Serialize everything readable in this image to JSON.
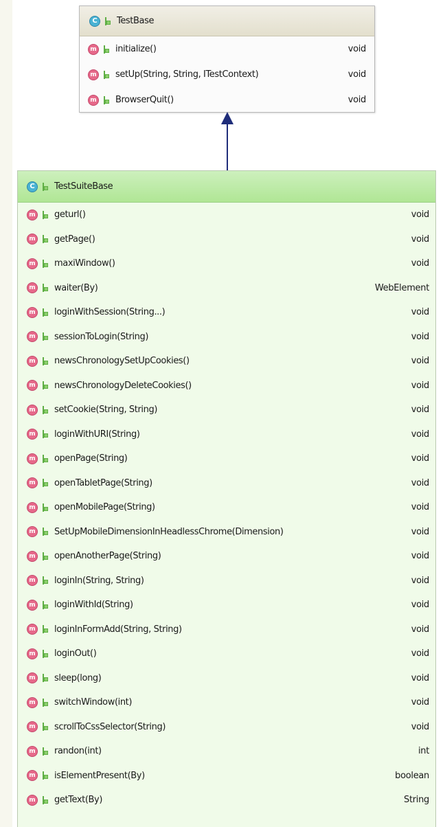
{
  "parent_class": {
    "name": "TestBase",
    "icon": "class-icon",
    "methods": [
      {
        "name": "initialize()",
        "type": "void"
      },
      {
        "name": "setUp(String, String, ITestContext)",
        "type": "void"
      },
      {
        "name": "BrowserQuit()",
        "type": "void"
      }
    ]
  },
  "child_class": {
    "name": "TestSuiteBase",
    "icon": "class-icon",
    "methods": [
      {
        "name": "geturl()",
        "type": "void"
      },
      {
        "name": "getPage()",
        "type": "void"
      },
      {
        "name": "maxiWindow()",
        "type": "void"
      },
      {
        "name": "waiter(By)",
        "type": "WebElement"
      },
      {
        "name": "loginWithSession(String...)",
        "type": "void"
      },
      {
        "name": "sessionToLogin(String)",
        "type": "void"
      },
      {
        "name": "newsChronologySetUpCookies()",
        "type": "void"
      },
      {
        "name": "newsChronologyDeleteCookies()",
        "type": "void"
      },
      {
        "name": "setCookie(String, String)",
        "type": "void"
      },
      {
        "name": "loginWithURI(String)",
        "type": "void"
      },
      {
        "name": "openPage(String)",
        "type": "void"
      },
      {
        "name": "openTabletPage(String)",
        "type": "void"
      },
      {
        "name": "openMobilePage(String)",
        "type": "void"
      },
      {
        "name": "SetUpMobileDimensionInHeadlessChrome(Dimension)",
        "type": "void"
      },
      {
        "name": "openAnotherPage(String)",
        "type": "void"
      },
      {
        "name": "loginIn(String, String)",
        "type": "void"
      },
      {
        "name": "loginWithId(String)",
        "type": "void"
      },
      {
        "name": "loginInFormAdd(String, String)",
        "type": "void"
      },
      {
        "name": "loginOut()",
        "type": "void"
      },
      {
        "name": "sleep(long)",
        "type": "void"
      },
      {
        "name": "switchWindow(int)",
        "type": "void"
      },
      {
        "name": "scrollToCssSelector(String)",
        "type": "void"
      },
      {
        "name": "randon(int)",
        "type": "int"
      },
      {
        "name": "isElementPresent(By)",
        "type": "boolean"
      },
      {
        "name": "getText(By)",
        "type": "String"
      }
    ]
  },
  "relation": {
    "type": "inheritance",
    "from": "TestSuiteBase",
    "to": "TestBase"
  },
  "colors": {
    "parent_header": "#e3dfcd",
    "child_header": "#b0e695",
    "child_body": "#f0fbe9",
    "method_icon": "#e6698a",
    "class_icon": "#4ab3d4",
    "arrow": "#1f2d7a"
  },
  "icons": {
    "class": "C",
    "method": "m"
  }
}
